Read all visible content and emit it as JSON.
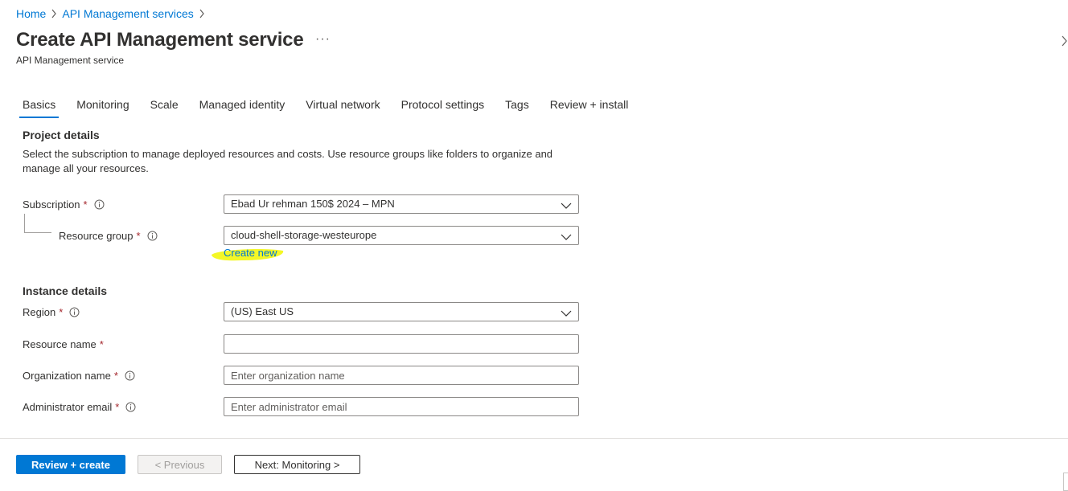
{
  "breadcrumb": {
    "home": "Home",
    "services": "API Management services"
  },
  "page": {
    "title": "Create API Management service",
    "subtitle": "API Management service",
    "more": "···"
  },
  "tabs": [
    {
      "label": "Basics",
      "active": true
    },
    {
      "label": "Monitoring"
    },
    {
      "label": "Scale"
    },
    {
      "label": "Managed identity"
    },
    {
      "label": "Virtual network"
    },
    {
      "label": "Protocol settings"
    },
    {
      "label": "Tags"
    },
    {
      "label": "Review + install"
    }
  ],
  "project": {
    "title": "Project details",
    "description": "Select the subscription to manage deployed resources and costs. Use resource groups like folders to organize and manage all your resources.",
    "subscription": {
      "label": "Subscription",
      "required": "*",
      "value": "Ebad Ur rehman 150$ 2024 – MPN"
    },
    "resource_group": {
      "label": "Resource group",
      "required": "*",
      "value": "cloud-shell-storage-westeurope",
      "create_new": "Create new"
    }
  },
  "instance": {
    "title": "Instance details",
    "region": {
      "label": "Region",
      "required": "*",
      "value": "(US) East US"
    },
    "resource_name": {
      "label": "Resource name",
      "required": "*",
      "value": ""
    },
    "org_name": {
      "label": "Organization name",
      "required": "*",
      "placeholder": "Enter organization name"
    },
    "admin_email": {
      "label": "Administrator email",
      "required": "*",
      "placeholder": "Enter administrator email"
    }
  },
  "footer": {
    "review_create": "Review + create",
    "previous": "< Previous",
    "next": "Next: Monitoring >"
  },
  "colors": {
    "accent": "#0078d4",
    "required": "#a4262c",
    "highlight": "#f3f71a"
  },
  "icons": {
    "info": "info-icon",
    "chevron": "chevron-down-icon",
    "breadcrumb_sep": "chevron-right-icon"
  }
}
